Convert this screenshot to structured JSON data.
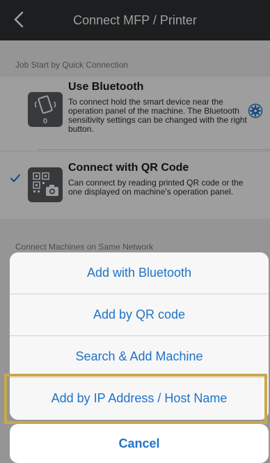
{
  "navbar": {
    "title": "Connect MFP / Printer"
  },
  "sections": {
    "quick": "Job Start by Quick Connection",
    "network": "Connect Machines on Same Network"
  },
  "options": {
    "bluetooth": {
      "title": "Use Bluetooth",
      "description": "To connect hold the smart device near the operation panel of the machine. The Bluetooth sensitivity settings can be changed with the right button.",
      "icon_badge": "0"
    },
    "qr": {
      "title": "Connect with QR Code",
      "description": "Can connect by reading printed QR code or the one displayed on machine's operation panel."
    }
  },
  "action_sheet": {
    "items": [
      "Add with Bluetooth",
      "Add by QR code",
      "Search & Add Machine",
      "Add by IP Address / Host Name"
    ],
    "cancel": "Cancel"
  },
  "colors": {
    "accent": "#1f73c9",
    "navbar": "#2f3133",
    "highlight": "#c8a84a"
  }
}
